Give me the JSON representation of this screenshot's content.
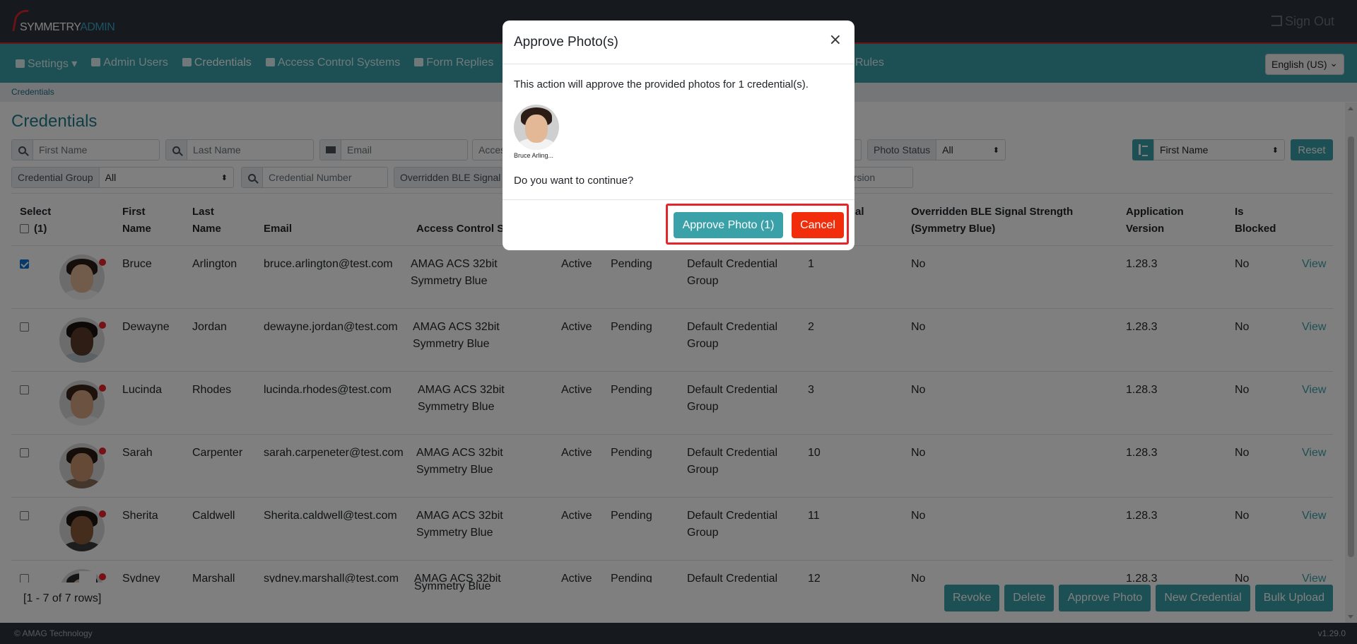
{
  "header": {
    "logo_prefix": "SYMMETRY",
    "logo_suffix": "ADMIN",
    "sign_out": "Sign Out"
  },
  "nav": {
    "items": [
      {
        "label": "Settings ▾",
        "icon": "gear-icon"
      },
      {
        "label": "Admin Users",
        "icon": "users-icon"
      },
      {
        "label": "Credentials",
        "icon": "card-icon"
      },
      {
        "label": "Access Control Systems",
        "icon": "car-icon"
      },
      {
        "label": "Form Replies",
        "icon": "comment-icon"
      }
    ],
    "rules": "Rules",
    "language": "English (US)"
  },
  "breadcrumb": "Credentials",
  "page_title": "Credentials",
  "filters": {
    "first_name_ph": "First Name",
    "last_name_ph": "Last Name",
    "email_ph": "Email",
    "access_ph": "Acces",
    "photo_status_label": "Photo Status",
    "photo_status_value": "All",
    "sort_value": "First Name",
    "reset": "Reset",
    "credential_group_label": "Credential Group",
    "credential_group_value": "All",
    "credential_number_ph": "Credential Number",
    "overridden_ble_label": "Overridden BLE Signal S",
    "version_ph": "ersion"
  },
  "table": {
    "headers": {
      "select": "Select",
      "select_count": "(1)",
      "first_name_1": "First",
      "first_name_2": "Name",
      "last_name_1": "Last",
      "last_name_2": "Name",
      "email": "Email",
      "access": "Access Control S",
      "credential_number": "al",
      "ble_1": "Overridden BLE Signal Strength",
      "ble_2": "(Symmetry Blue)",
      "app_1": "Application",
      "app_2": "Version",
      "blocked_1": "Is",
      "blocked_2": "Blocked"
    },
    "rows": [
      {
        "checked": true,
        "first": "Bruce",
        "last": "Arlington",
        "email": "bruce.arlington@test.com",
        "acs1": "AMAG ACS 32bit",
        "acs2": "Symmetry Blue",
        "status": "Active",
        "photo": "Pending",
        "group1": "Default Credential",
        "group2": "Group",
        "number": "1",
        "ble": "No",
        "version": "1.28.3",
        "blocked": "No",
        "view": "View",
        "skin": "#e3b896",
        "hair": "#2b1d16",
        "shirt": "#f2f2f2"
      },
      {
        "checked": false,
        "first": "Dewayne",
        "last": "Jordan",
        "email": "dewayne.jordan@test.com",
        "acs1": "AMAG ACS 32bit",
        "acs2": "Symmetry Blue",
        "status": "Active",
        "photo": "Pending",
        "group1": "Default Credential",
        "group2": "Group",
        "number": "2",
        "ble": "No",
        "version": "1.28.3",
        "blocked": "No",
        "view": "View",
        "skin": "#5a3a28",
        "hair": "#1a1210",
        "shirt": "#b9c3cc"
      },
      {
        "checked": false,
        "first": "Lucinda",
        "last": "Rhodes",
        "email": "lucinda.rhodes@test.com",
        "acs1": "AMAG ACS 32bit",
        "acs2": "Symmetry Blue",
        "status": "Active",
        "photo": "Pending",
        "group1": "Default Credential",
        "group2": "Group",
        "number": "3",
        "ble": "No",
        "version": "1.28.3",
        "blocked": "No",
        "view": "View",
        "skin": "#d9a583",
        "hair": "#3a2518",
        "shirt": "#ececec"
      },
      {
        "checked": false,
        "first": "Sarah",
        "last": "Carpenter",
        "email": "sarah.carpeneter@test.com",
        "acs1": "AMAG ACS 32bit",
        "acs2": "Symmetry Blue",
        "status": "Active",
        "photo": "Pending",
        "group1": "Default Credential",
        "group2": "Group",
        "number": "10",
        "ble": "No",
        "version": "1.28.3",
        "blocked": "No",
        "view": "View",
        "skin": "#c8946f",
        "hair": "#2a1a12",
        "shirt": "#8c6e5a"
      },
      {
        "checked": false,
        "first": "Sherita",
        "last": "Caldwell",
        "email": "Sherita.caldwell@test.com",
        "acs1": "AMAG ACS 32bit",
        "acs2": "Symmetry Blue",
        "status": "Active",
        "photo": "Pending",
        "group1": "Default Credential",
        "group2": "Group",
        "number": "11",
        "ble": "No",
        "version": "1.28.3",
        "blocked": "No",
        "view": "View",
        "skin": "#8a5a3c",
        "hair": "#1c1410",
        "shirt": "#3a3a3a"
      },
      {
        "checked": false,
        "first": "Sydney",
        "last": "Marshall",
        "email": "sydney.marshall@test.com",
        "acs1": "AMAG ACS 32bit",
        "acs2": "Symmetry Blue",
        "status": "Active",
        "photo": "Pending",
        "group1": "Default Credential",
        "group2": "",
        "number": "12",
        "ble": "No",
        "version": "1.28.3",
        "blocked": "No",
        "view": "View",
        "skin": "#d6c2b2",
        "hair": "#2a2a2a",
        "shirt": "#666666"
      }
    ],
    "row_count": "[1 - 7 of 7 rows]"
  },
  "actions": {
    "revoke": "Revoke",
    "delete": "Delete",
    "approve_photo": "Approve Photo",
    "new_credential": "New Credential",
    "bulk_upload": "Bulk Upload"
  },
  "footer": {
    "copyright": "© AMAG Technology",
    "version": "v1.29.0"
  },
  "modal": {
    "title": "Approve Photo(s)",
    "close": "×",
    "message": "This action will approve the provided photos for 1 credential(s).",
    "thumb_name": "Bruce Arling...",
    "question": "Do you want to continue?",
    "approve_label": "Approve Photo (1)",
    "cancel_label": "Cancel"
  },
  "colors": {
    "accent": "#3aa1a8",
    "danger": "#f12d0b",
    "header": "#2c333b"
  }
}
